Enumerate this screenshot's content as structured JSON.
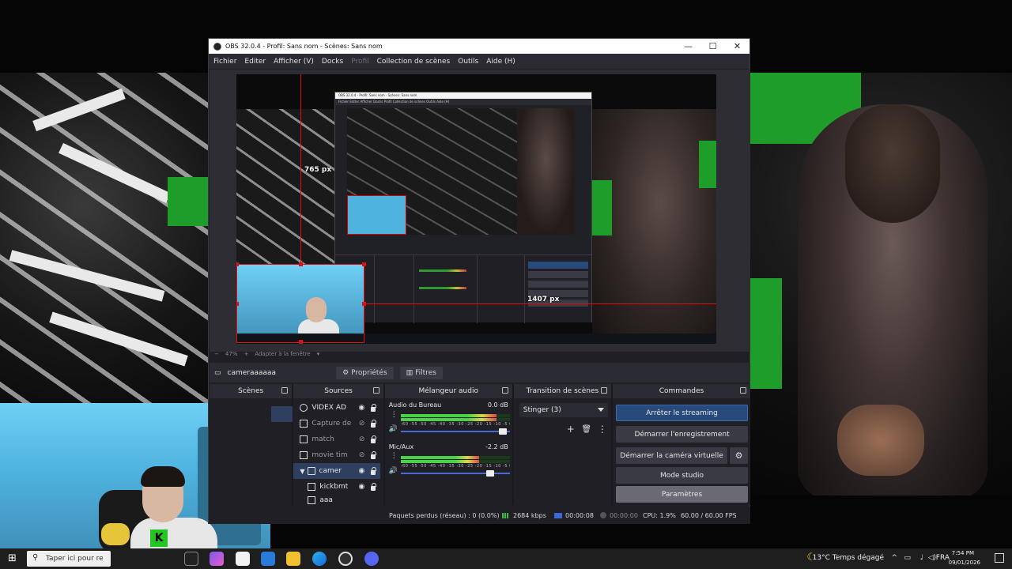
{
  "window": {
    "title": "OBS 32.0.4 - Profil: Sans nom - Scènes: Sans nom",
    "controls": {
      "minimize": "—",
      "maximize": "☐",
      "close": "✕"
    }
  },
  "menu": [
    {
      "label": "Fichier",
      "enabled": true
    },
    {
      "label": "Editer",
      "enabled": true
    },
    {
      "label": "Afficher (V)",
      "enabled": true
    },
    {
      "label": "Docks",
      "enabled": true
    },
    {
      "label": "Profil",
      "enabled": false
    },
    {
      "label": "Collection de scènes",
      "enabled": true
    },
    {
      "label": "Outils",
      "enabled": true
    },
    {
      "label": "Aide (H)",
      "enabled": true
    }
  ],
  "preview": {
    "width_label": "1407 px",
    "height_label": "765 px",
    "nested_title": "OBS 32.0.4 - Profil: Sans nom - Scènes: Sans nom",
    "nested_menu": "Fichier Editer Afficher Docks Profil Collection de scènes Outils Aide (H)",
    "nested_taskbar_search": "Taper ici pour re",
    "nested_weather": "13°C  Temps dégagé"
  },
  "zoom": {
    "percent": "47%",
    "fit_label": "Adapter à la fenêtre"
  },
  "context": {
    "source_name": "cameraaaaaa",
    "properties_label": "Propriétés",
    "filters_label": "Filtres"
  },
  "docks": {
    "scenes_title": "Scènes",
    "sources_title": "Sources",
    "mixer_title": "Mélangeur audio",
    "transitions_title": "Transition de scènes",
    "commands_title": "Commandes"
  },
  "sources": [
    {
      "name": "VIDEX AD",
      "icon": "globe-icon",
      "indent": 0,
      "expand": ""
    },
    {
      "name": "Capture de",
      "icon": "monitor-icon",
      "indent": 0,
      "expand": ""
    },
    {
      "name": "match",
      "icon": "image-icon",
      "indent": 0,
      "expand": ""
    },
    {
      "name": "movie tim",
      "icon": "image-icon",
      "indent": 0,
      "expand": ""
    },
    {
      "name": "camer",
      "icon": "folder-icon",
      "indent": 0,
      "expand": "▼",
      "selected": true
    },
    {
      "name": "kickbmt",
      "icon": "image-icon",
      "indent": 1,
      "expand": ""
    },
    {
      "name": "aaa",
      "icon": "image-icon",
      "indent": 1,
      "expand": ""
    }
  ],
  "mixer": [
    {
      "name": "Audio du Bureau",
      "db": "0.0 dB",
      "level": 0.88,
      "volume": 0.97
    },
    {
      "name": "Mic/Aux",
      "db": "-2.2 dB",
      "level": 0.72,
      "volume": 0.86
    }
  ],
  "mixer_scale": "-60 -55 -50 -45 -40 -35 -30 -25 -20 -15 -10 -5 0",
  "transition": {
    "selected": "Stinger (3)",
    "add": "+",
    "remove": "🗑",
    "more": "⋮"
  },
  "commands": {
    "stop_streaming": "Arrêter le streaming",
    "start_recording": "Démarrer l'enregistrement",
    "start_virtualcam": "Démarrer la caméra virtuelle",
    "studio_mode": "Mode studio",
    "settings": "Paramètres"
  },
  "status": {
    "dropped": "Paquets perdus (réseau) : 0 (0.0%)",
    "bitrate": "2684 kbps",
    "stream_time": "00:00:08",
    "record_time": "00:00:00",
    "cpu": "CPU: 1.9%",
    "fps": "60.00 / 60.00 FPS"
  },
  "taskbar": {
    "search_placeholder": "Taper ici pour re",
    "weather": "13°C  Temps dégagé",
    "language": "FRA",
    "time": "7:54 PM",
    "date": "09/01/2026"
  },
  "colors": {
    "obs_bg": "#1f1f25",
    "dock_header": "#2b2b33",
    "selection": "#2f3f5f",
    "primary_button": "#284a7a",
    "guide_red": "#e01010",
    "meter_green": "#4ad14a"
  }
}
